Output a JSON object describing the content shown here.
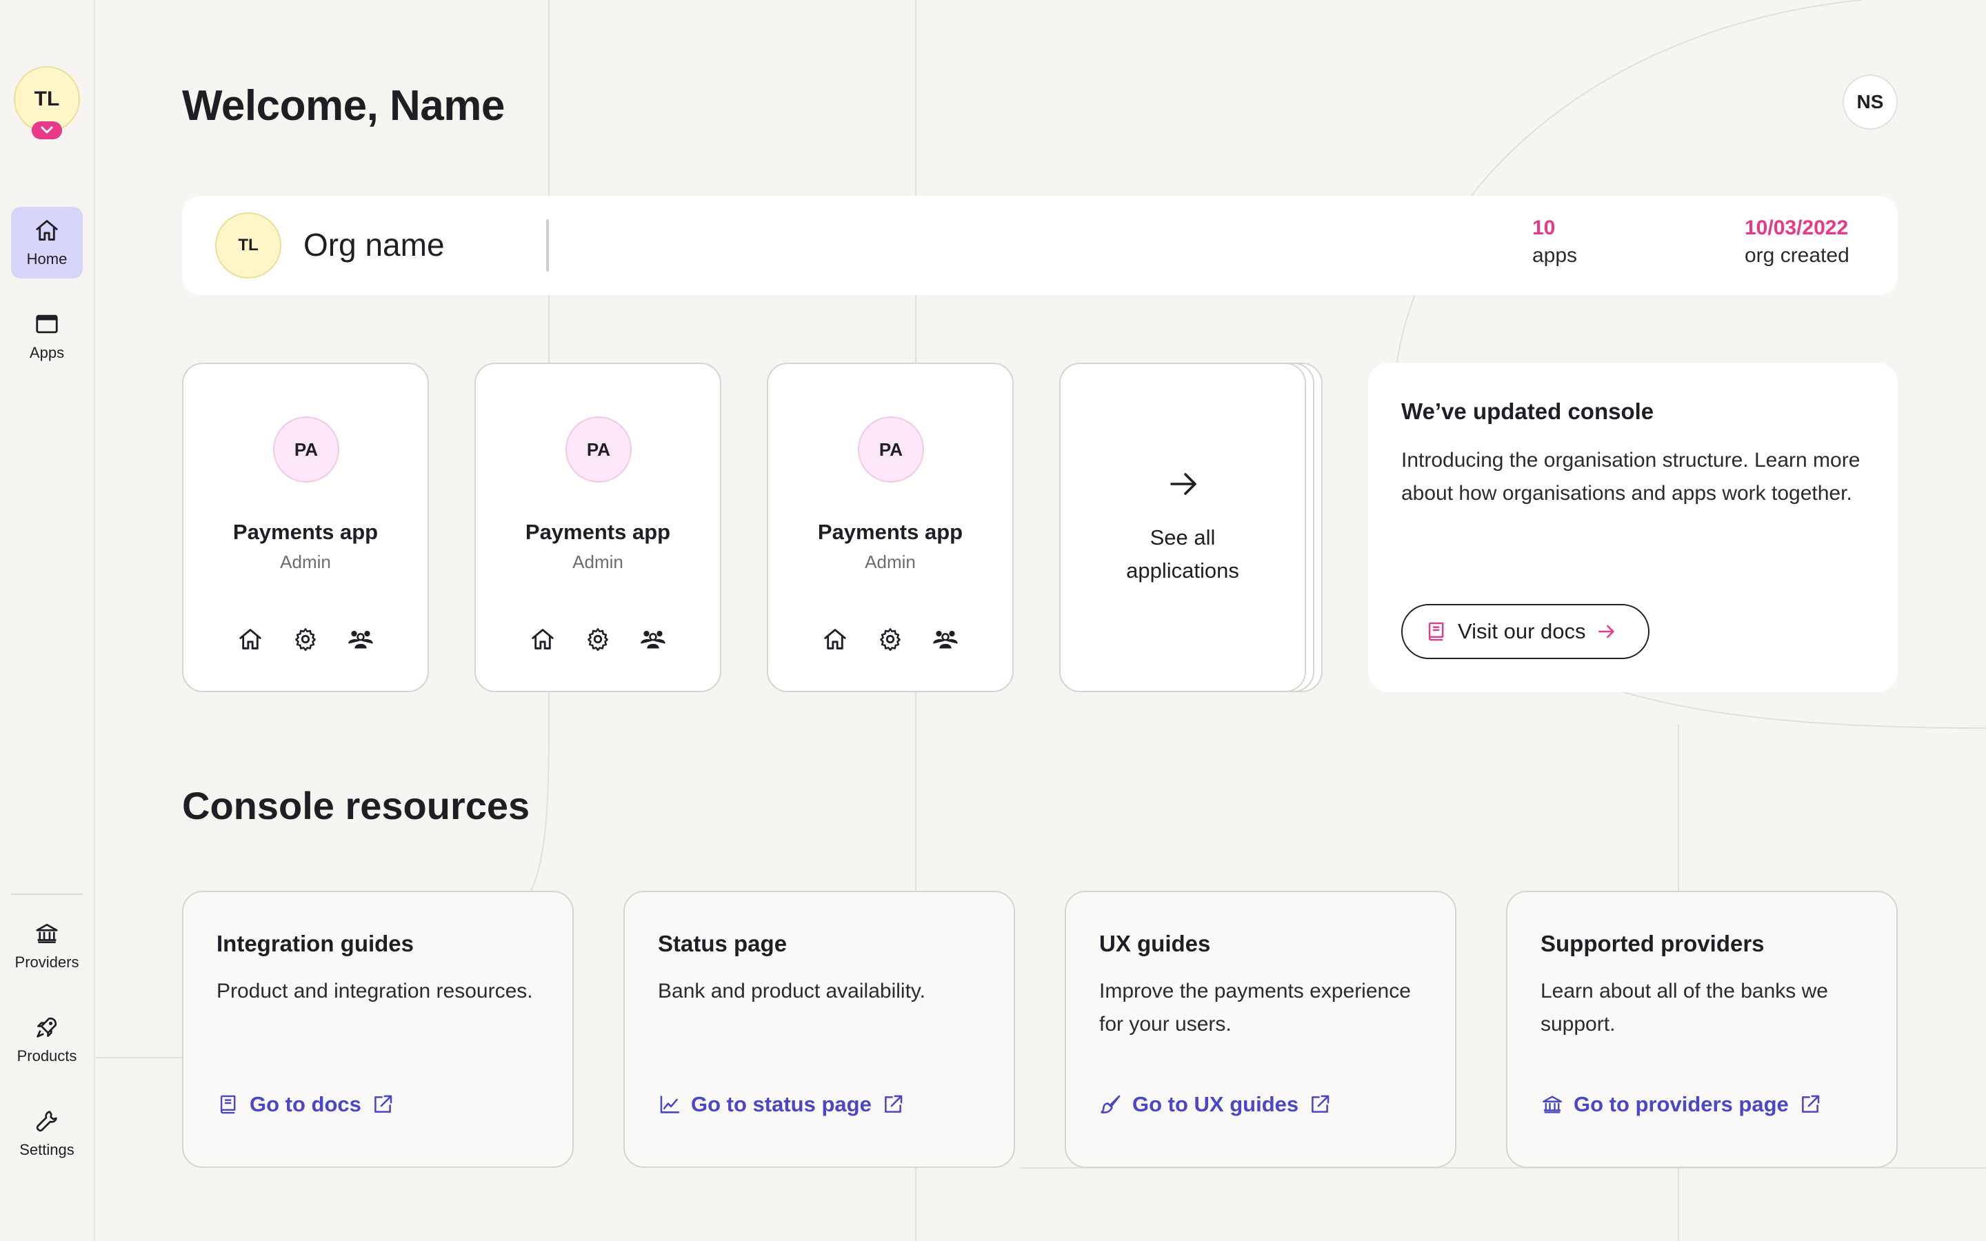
{
  "sidebar": {
    "org_initials": "TL",
    "nav": [
      {
        "label": "Home",
        "icon": "home-icon"
      },
      {
        "label": "Apps",
        "icon": "window-icon"
      }
    ],
    "bottom_nav": [
      {
        "label": "Providers",
        "icon": "bank-icon"
      },
      {
        "label": "Products",
        "icon": "rocket-icon"
      },
      {
        "label": "Settings",
        "icon": "wrench-icon"
      }
    ]
  },
  "header": {
    "title": "Welcome, Name",
    "user_initials": "NS"
  },
  "org_bar": {
    "initials": "TL",
    "name": "Org name",
    "apps_count": "10",
    "apps_caption": "apps",
    "created_date": "10/03/2022",
    "created_caption": "org created"
  },
  "apps": [
    {
      "initials": "PA",
      "name": "Payments app",
      "role": "Admin"
    },
    {
      "initials": "PA",
      "name": "Payments app",
      "role": "Admin"
    },
    {
      "initials": "PA",
      "name": "Payments app",
      "role": "Admin"
    }
  ],
  "see_all": {
    "label": "See all applications"
  },
  "update": {
    "heading": "We’ve updated console",
    "body": "Introducing the organisation structure. Learn more about how organisations and apps work together.",
    "button": "Visit our docs"
  },
  "resources": {
    "title": "Console resources",
    "cards": [
      {
        "heading": "Integration guides",
        "body": "Product and integration resources.",
        "link": "Go to docs",
        "icon": "book-icon"
      },
      {
        "heading": "Status page",
        "body": "Bank and product availability.",
        "link": "Go to status page",
        "icon": "chart-line-icon"
      },
      {
        "heading": "UX guides",
        "body": "Improve the payments experience for your users.",
        "link": "Go to UX guides",
        "icon": "brush-icon"
      },
      {
        "heading": "Supported providers",
        "body": "Learn about all of the banks we support.",
        "link": "Go to providers page",
        "icon": "bank-icon"
      }
    ]
  },
  "colors": {
    "accent_pink": "#e8388a",
    "link_purple": "#4a46c8",
    "active_nav": "#d8d5fb",
    "avatar_yellow": "#fff6c8",
    "app_avatar_pink": "#fbe7f7"
  }
}
